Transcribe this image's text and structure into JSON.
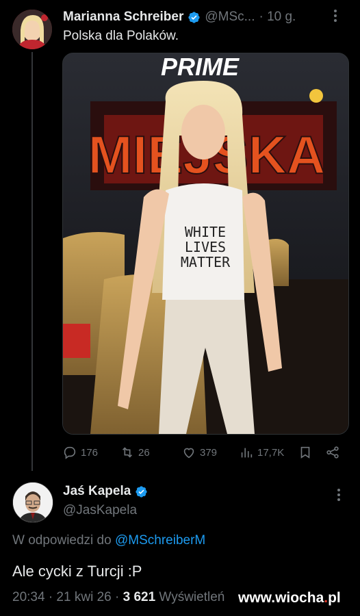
{
  "tweet": {
    "name": "Marianna Schreiber",
    "handle": "@MSc...",
    "time": "· 10 g.",
    "text": "Polska dla Polaków.",
    "image_text": {
      "logo": "PRIME",
      "banner": "MIEJSKA",
      "shirt_line1": "WHITE",
      "shirt_line2": "LIVES",
      "shirt_line3": "MATTER"
    },
    "actions": {
      "replies": "176",
      "retweets": "26",
      "likes": "379",
      "views": "17,7K"
    }
  },
  "reply": {
    "name": "Jaś Kapela",
    "handle": "@JasKapela",
    "reply_to_prefix": "W odpowiedzi do",
    "reply_to_mention": "@MSchreiberM",
    "text": "Ale cycki z Turcji :P",
    "time": "20:34 · 21 kwi 26 ·",
    "views_count": "3 621",
    "views_label": "Wyświetleń"
  },
  "watermark": {
    "prefix": "www.",
    "brand": "wiocha",
    "dot": ".",
    "tld": "pl"
  },
  "colors": {
    "background": "#000000",
    "text": "#e7e9ea",
    "muted": "#71767b",
    "accent": "#1d9bf0"
  },
  "icons": [
    "verified-badge-icon",
    "more-icon",
    "reply-icon",
    "retweet-icon",
    "like-icon",
    "views-icon",
    "bookmark-icon",
    "share-icon"
  ]
}
